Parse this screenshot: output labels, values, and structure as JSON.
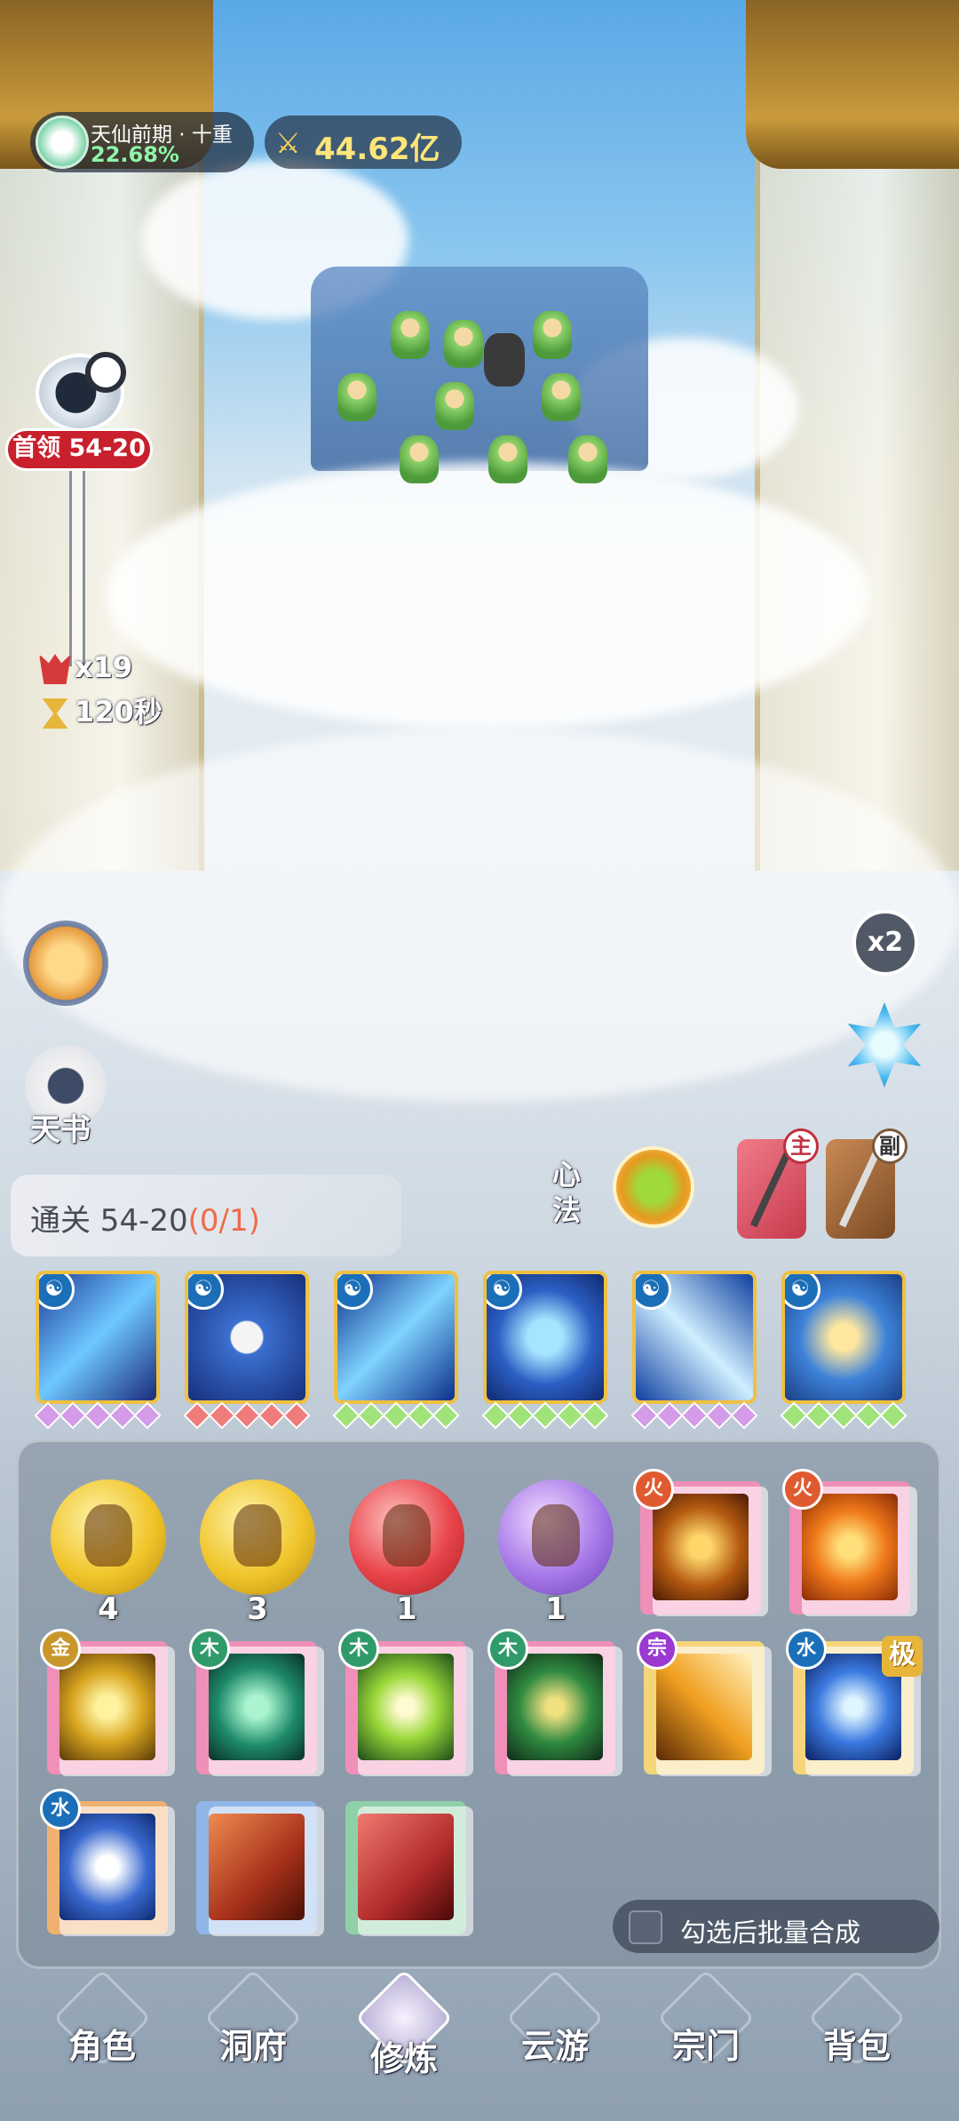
{
  "hud": {
    "realm_name": "天仙前期 · 十重",
    "realm_progress": "22.68%",
    "power_value": "44.62亿"
  },
  "stage": {
    "boss_label": "首领 54-20",
    "enemy_count": "x19",
    "time_left": "120秒"
  },
  "side": {
    "book_label": "天书",
    "speed_label": "x2"
  },
  "clear": {
    "prefix": "通关 54-20",
    "progress": "(0/1)"
  },
  "xinfa_label": "心法",
  "weapons": {
    "main_tag": "主",
    "sub_tag": "副"
  },
  "equipped_skills": [
    {
      "gems": [
        "#d39be8",
        "#d39be8",
        "#d39be8",
        "#d39be8",
        "#d39be8"
      ],
      "art": "linear-gradient(135deg,#1d3c9a,#6fc8ff 50%,#1a2a7a)"
    },
    {
      "gems": [
        "#f07b7b",
        "#f07b7b",
        "#f07b7b",
        "#f07b7b",
        "#f07b7b"
      ],
      "art": "radial-gradient(circle,#f4f4f4 18%,#3b6fd0 20%,#16307c)"
    },
    {
      "gems": [
        "#9fe37a",
        "#9fe37a",
        "#9fe37a",
        "#9fe37a",
        "#9fe37a"
      ],
      "art": "linear-gradient(135deg,#0e2f8a,#7fd3ff 50%,#0e2f8a)"
    },
    {
      "gems": [
        "#9fe37a",
        "#9fe37a",
        "#9fe37a",
        "#9fe37a",
        "#9fe37a"
      ],
      "art": "radial-gradient(circle,#a7e4ff 20%,#2c5fc4 55%,#102a70)"
    },
    {
      "gems": [
        "#d39be8",
        "#d39be8",
        "#d39be8",
        "#d39be8",
        "#d39be8"
      ],
      "art": "linear-gradient(45deg,#0f3fa0,#cfefff 50%,#0f3fa0)"
    },
    {
      "gems": [
        "#9fe37a",
        "#9fe37a",
        "#9fe37a",
        "#9fe37a",
        "#9fe37a"
      ],
      "art": "radial-gradient(circle,#ffe7a0 15%,#3d82d8 50%,#1b3f86)"
    }
  ],
  "inventory": {
    "orbs": [
      {
        "count": "4",
        "color": "radial-gradient(circle at 40% 35%,#fff3a8,#f0c52a 55%,#b98a10)"
      },
      {
        "count": "3",
        "color": "radial-gradient(circle at 40% 35%,#fff3a8,#f0c52a 55%,#b98a10)"
      },
      {
        "count": "1",
        "color": "radial-gradient(circle at 40% 35%,#ffc0c0,#e8454a 55%,#a81e25)"
      },
      {
        "count": "1",
        "color": "radial-gradient(circle at 40% 35%,#f2dcff,#a678e8 55%,#6b3fb8)"
      }
    ],
    "batch_label": "勾选后批量合成"
  },
  "nav": {
    "items": [
      "角色",
      "洞府",
      "修炼",
      "云游",
      "宗门",
      "背包"
    ]
  }
}
